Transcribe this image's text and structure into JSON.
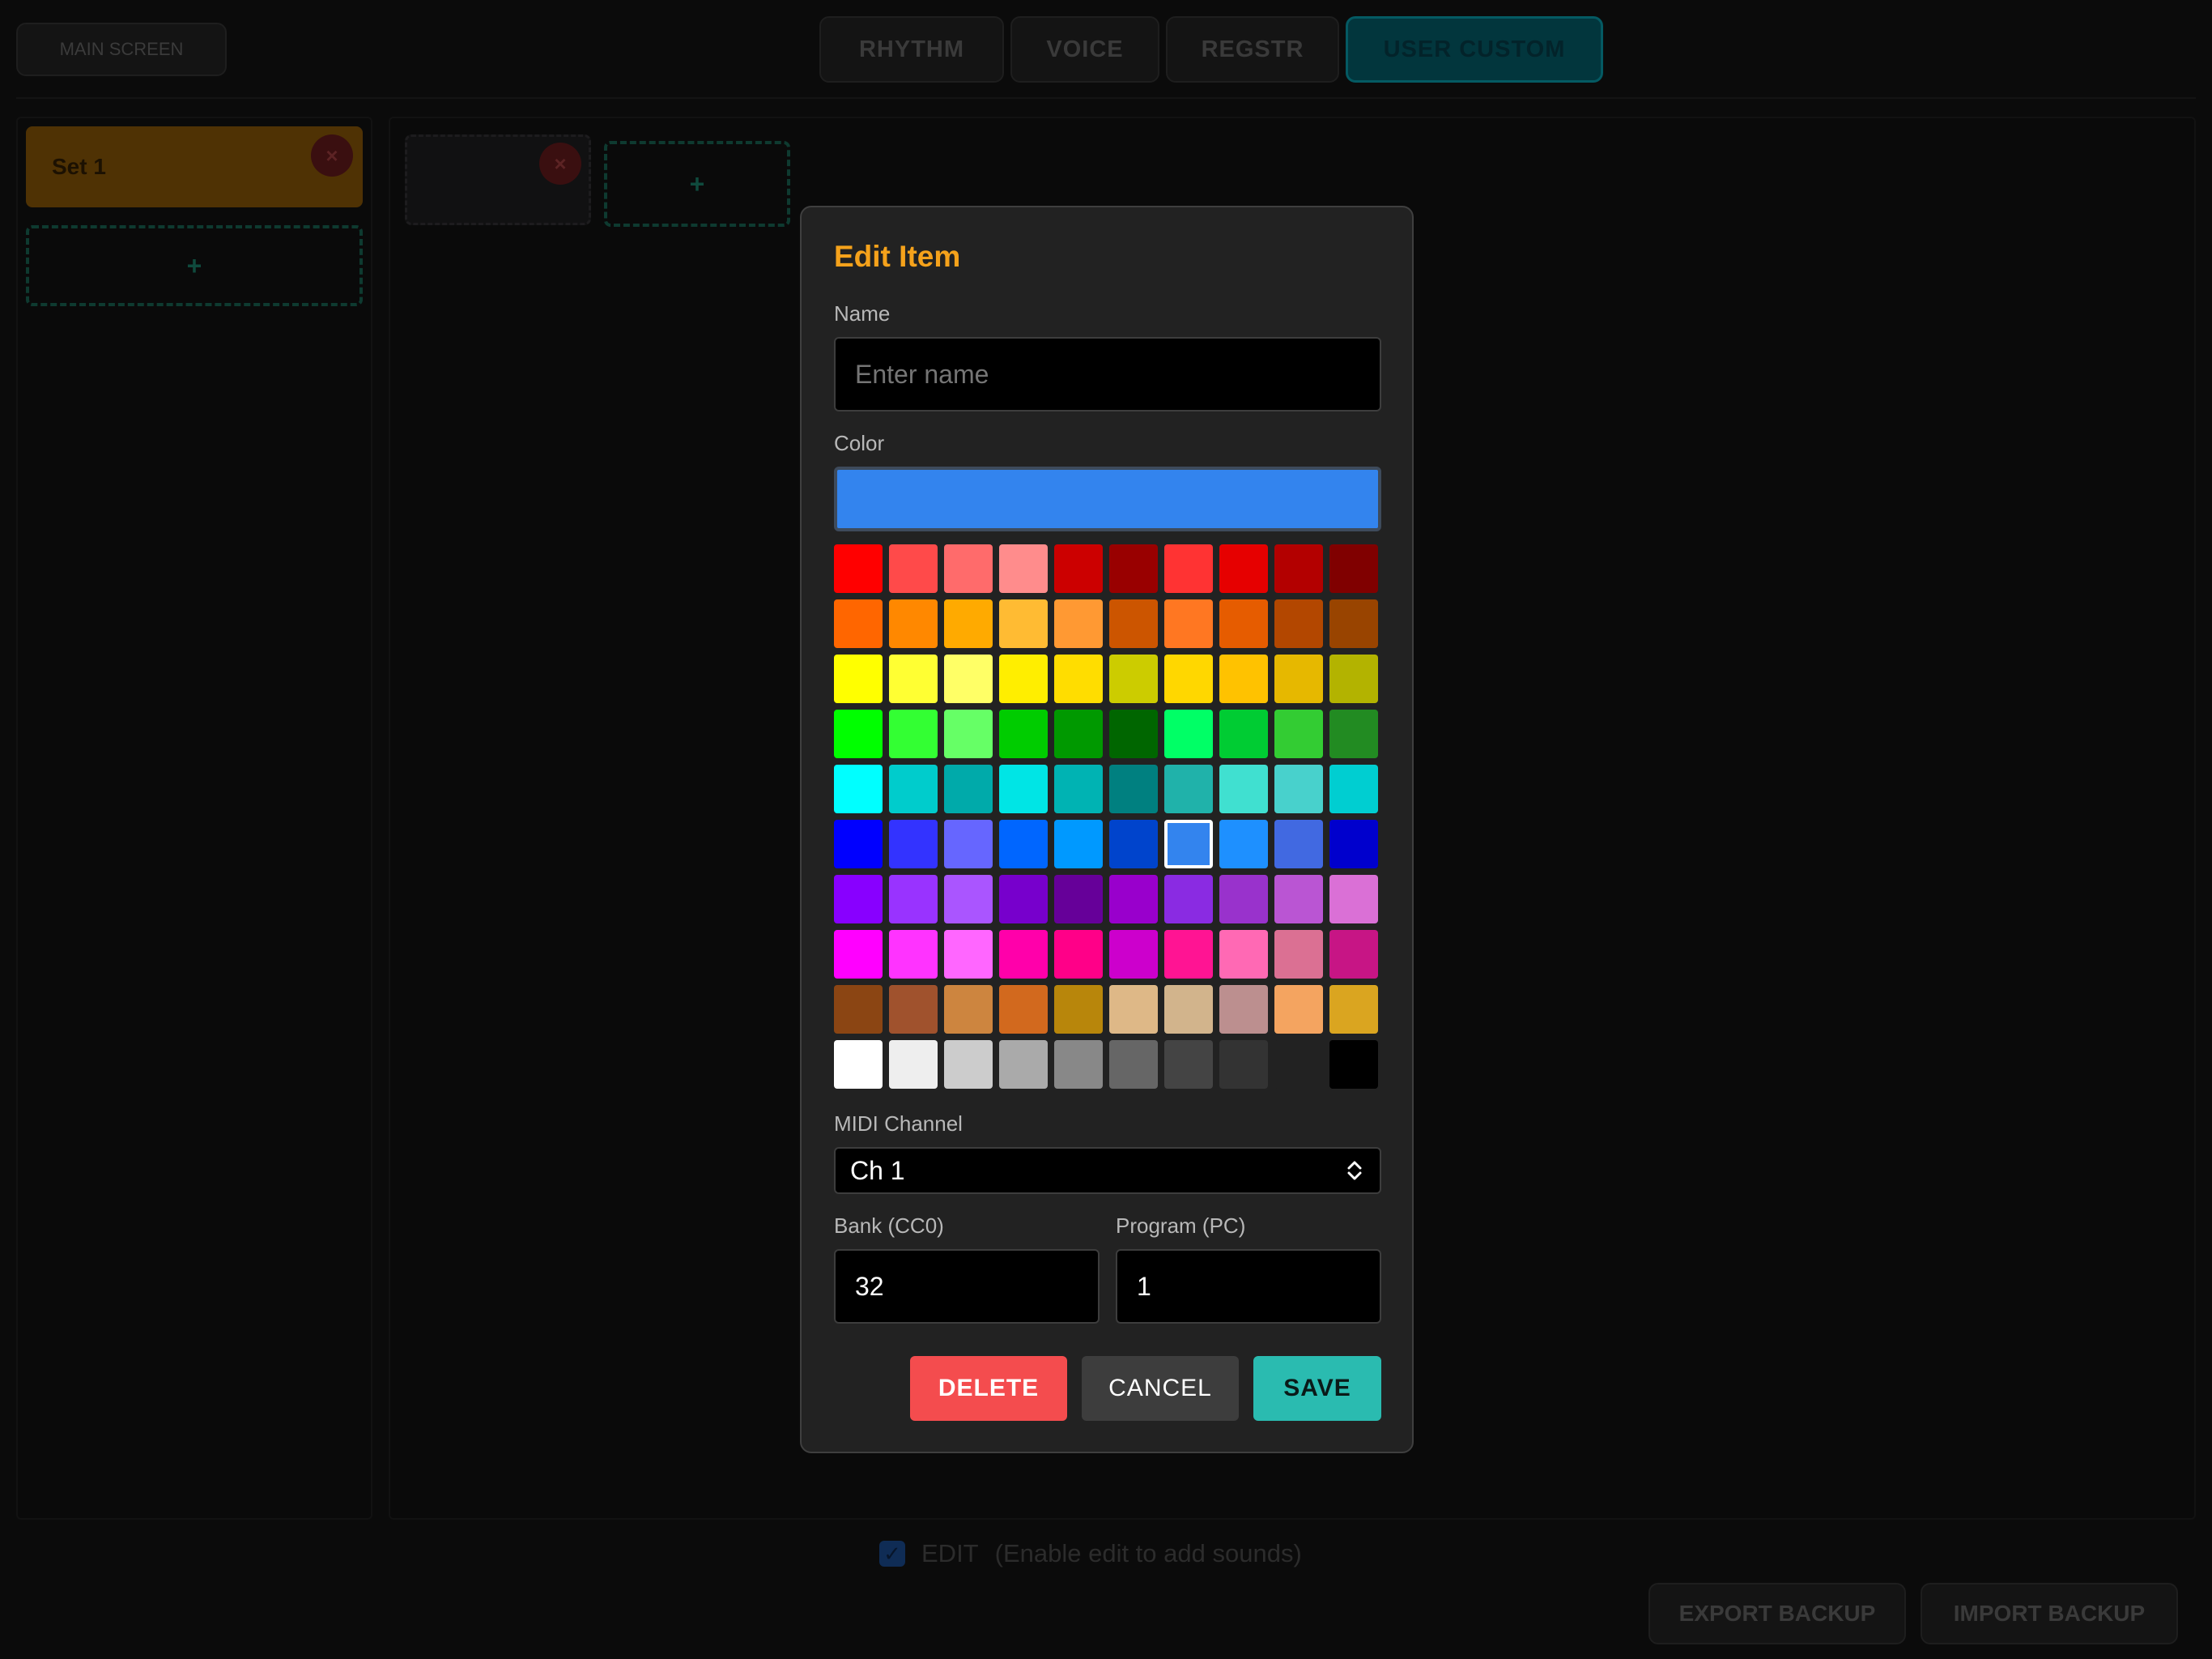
{
  "topbar": {
    "main_screen_label": "MAIN SCREEN",
    "tabs": [
      {
        "label": "RHYTHM",
        "active": false
      },
      {
        "label": "VOICE",
        "active": false
      },
      {
        "label": "REGSTR",
        "active": false
      },
      {
        "label": "USER CUSTOM",
        "active": true
      }
    ]
  },
  "sets": {
    "items": [
      {
        "label": "Set 1",
        "remove_icon": "×"
      }
    ],
    "add_icon": "+"
  },
  "items_area": {
    "remove_icon": "×",
    "add_icon": "+"
  },
  "footer": {
    "edit_checked": true,
    "checkmark": "✓",
    "edit_label": "EDIT",
    "edit_hint": "(Enable edit to add sounds)",
    "export_label": "EXPORT BACKUP",
    "import_label": "IMPORT BACKUP"
  },
  "dialog": {
    "title": "Edit Item",
    "name_label": "Name",
    "name_value": "",
    "name_placeholder": "Enter name",
    "color_label": "Color",
    "selected_color": "#3384ee",
    "palette": [
      [
        "#ff0000",
        "#ff4a4a",
        "#ff6b6b",
        "#ff8c8c",
        "#cc0000",
        "#990000",
        "#ff3333",
        "#e60000",
        "#b30000",
        "#800000"
      ],
      [
        "#ff6600",
        "#ff8800",
        "#ffaa00",
        "#ffbb33",
        "#ff9933",
        "#cc5500",
        "#ff7722",
        "#e65c00",
        "#b34700",
        "#994400"
      ],
      [
        "#ffff00",
        "#ffff33",
        "#ffff66",
        "#ffee00",
        "#ffdd00",
        "#cccc00",
        "#ffd700",
        "#ffc200",
        "#e6b800",
        "#b3b300"
      ],
      [
        "#00ff00",
        "#33ff33",
        "#66ff66",
        "#00cc00",
        "#009900",
        "#006600",
        "#00ff66",
        "#00cc33",
        "#33cc33",
        "#228b22"
      ],
      [
        "#00ffff",
        "#00cccc",
        "#00aaaa",
        "#00e5e5",
        "#00b3b3",
        "#008080",
        "#20b2aa",
        "#40e0d0",
        "#48d1cc",
        "#00ced1"
      ],
      [
        "#0000ff",
        "#3333ff",
        "#6666ff",
        "#0066ff",
        "#0099ff",
        "#0044cc",
        "#3384ee",
        "#1e90ff",
        "#4169e1",
        "#0000cd"
      ],
      [
        "#8800ff",
        "#9933ff",
        "#aa55ff",
        "#7700cc",
        "#660099",
        "#9900cc",
        "#8a2be2",
        "#9932cc",
        "#ba55d3",
        "#da70d6"
      ],
      [
        "#ff00ff",
        "#ff33ff",
        "#ff66ff",
        "#ff00aa",
        "#ff0088",
        "#cc00cc",
        "#ff1493",
        "#ff69b4",
        "#db7093",
        "#c71585"
      ],
      [
        "#8b4513",
        "#a0522d",
        "#cd853f",
        "#d2691e",
        "#b8860b",
        "#deb887",
        "#d2b48c",
        "#bc8f8f",
        "#f4a460",
        "#daa520"
      ],
      [
        "#ffffff",
        "#eeeeee",
        "#cccccc",
        "#aaaaaa",
        "#888888",
        "#666666",
        "#444444",
        "#333333",
        "#222222",
        "#000000"
      ]
    ],
    "midi_label": "MIDI Channel",
    "midi_value": "Ch 1",
    "midi_icon": "updown-chevron-icon",
    "bank_label": "Bank (CC0)",
    "bank_value": "32",
    "program_label": "Program (PC)",
    "program_value": "1",
    "delete_label": "DELETE",
    "cancel_label": "CANCEL",
    "save_label": "SAVE"
  }
}
